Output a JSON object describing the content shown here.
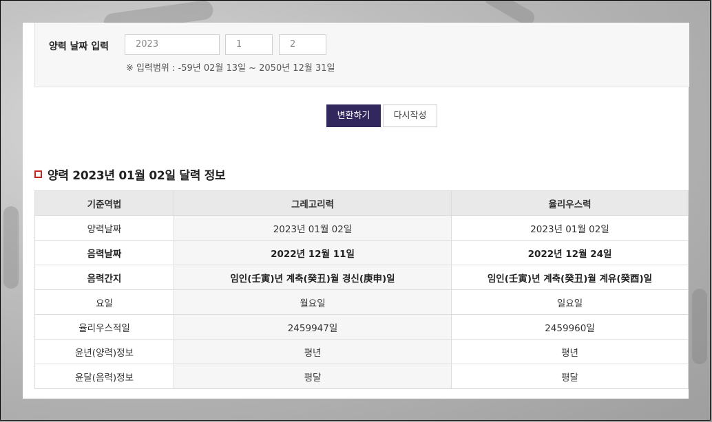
{
  "form": {
    "label": "양력 날짜 입력",
    "year_value": "2023",
    "month_value": "1",
    "day_value": "2",
    "range_note": "※ 입력범위 : -59년 02월 13일 ~ 2050년 12월 31일"
  },
  "buttons": {
    "convert": "변환하기",
    "reset": "다시작성"
  },
  "section": {
    "title": "양력 2023년 01월 02일 달력 정보"
  },
  "table": {
    "headers": [
      "기준역법",
      "그레고리력",
      "율리우스력"
    ],
    "rows": [
      {
        "label": "양력날짜",
        "gregorian": "2023년 01월 02일",
        "julian": "2023년 01월 02일",
        "bold": false
      },
      {
        "label": "음력날짜",
        "gregorian": "2022년 12월 11일",
        "julian": "2022년 12월 24일",
        "bold": true
      },
      {
        "label": "음력간지",
        "gregorian": "임인(壬寅)년 계축(癸丑)월 경신(庚申)일",
        "julian": "임인(壬寅)년 계축(癸丑)월 계유(癸酉)일",
        "bold": true
      },
      {
        "label": "요일",
        "gregorian": "월요일",
        "julian": "일요일",
        "bold": false
      },
      {
        "label": "율리우스적일",
        "gregorian": "2459947일",
        "julian": "2459960일",
        "bold": false
      },
      {
        "label": "윤년(양력)정보",
        "gregorian": "평년",
        "julian": "평년",
        "bold": false
      },
      {
        "label": "윤달(음력)정보",
        "gregorian": "평달",
        "julian": "평달",
        "bold": false
      }
    ]
  },
  "colors": {
    "accent": "#33285e",
    "title_marker": "#c8251e"
  }
}
